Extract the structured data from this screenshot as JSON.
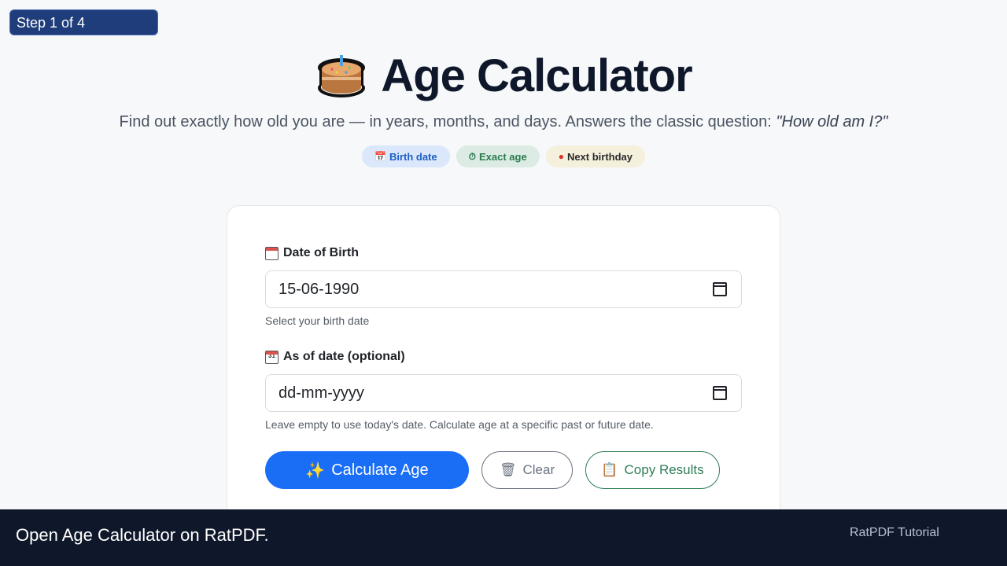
{
  "step_indicator": "Step 1 of 4",
  "header": {
    "title": "Age Calculator",
    "icon": "cake-icon",
    "subtitle_main": "Find out exactly how old you are — in years, months, and days. Answers the classic question: ",
    "subtitle_quote": "\"How old am I?\""
  },
  "badges": [
    {
      "icon": "calendar-icon",
      "label": "Birth date"
    },
    {
      "icon": "stopwatch-icon",
      "label": "Exact age"
    },
    {
      "icon": "balloon-icon",
      "label": "Next birthday"
    }
  ],
  "form": {
    "dob_label": "Date of Birth",
    "dob_value": "15-06-1990",
    "dob_hint": "Select your birth date",
    "asof_label": "As of date (optional)",
    "asof_placeholder": "dd-mm-yyyy",
    "asof_hint": "Leave empty to use today's date. Calculate age at a specific past or future date."
  },
  "buttons": {
    "calculate": "Calculate Age",
    "clear": "Clear",
    "copy": "Copy Results"
  },
  "footer": {
    "caption": "Open Age Calculator on RatPDF.",
    "brand": "RatPDF Tutorial"
  },
  "colors": {
    "primary": "#1a6ef5",
    "footer_bg": "#0f172a",
    "step_bg": "#1f3d7a"
  }
}
